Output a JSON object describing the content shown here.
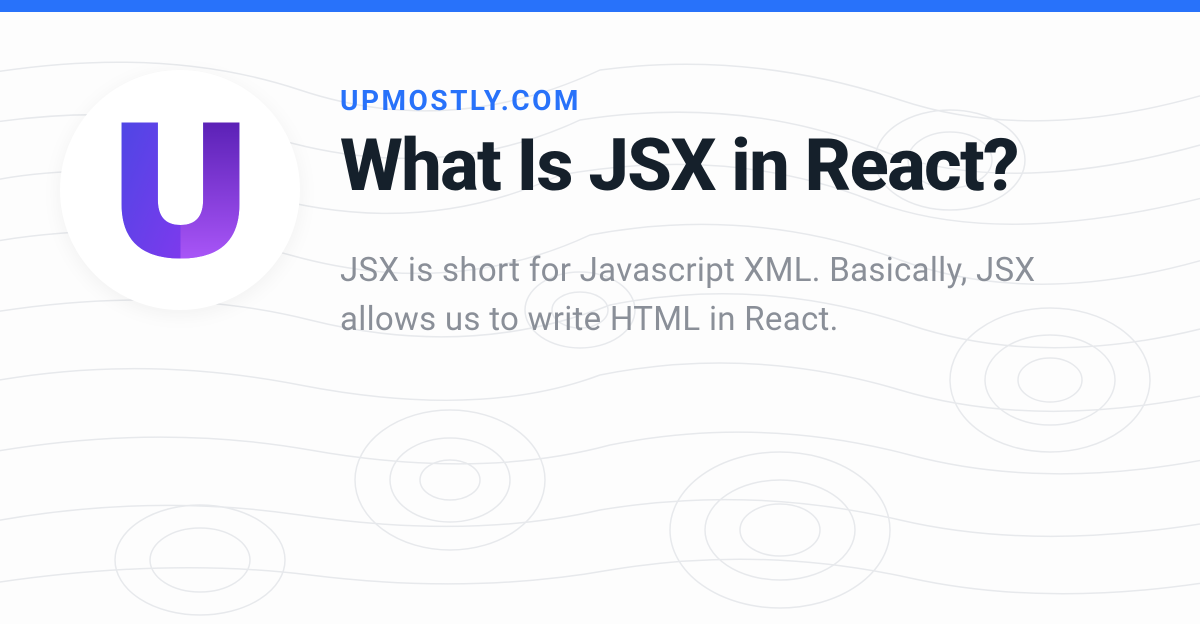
{
  "site_name": "UPMOSTLY.COM",
  "title": "What Is JSX in React?",
  "description": "JSX is short for Javascript XML. Basically, JSX allows us to write HTML in React.",
  "colors": {
    "accent": "#2872FA",
    "title": "#15202b",
    "description": "#8a8f98"
  }
}
